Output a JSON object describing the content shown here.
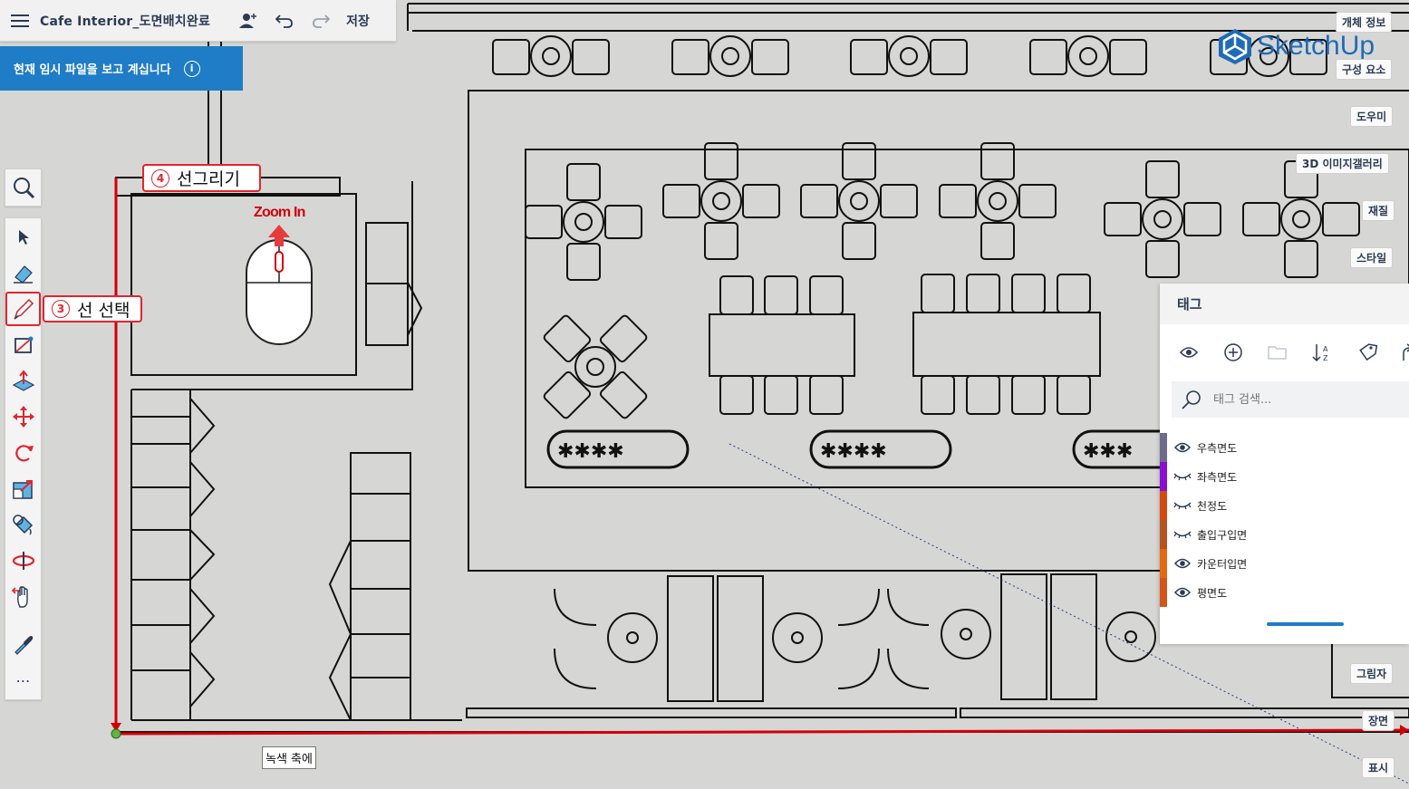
{
  "app": {
    "title": "Cafe Interior_도면배치완료",
    "save_label": "저장",
    "banner_text": "현재 임시 파일을 보고 계십니다",
    "brand": "SketchUp",
    "accent_color": "#1f7cc6",
    "callout_color": "#e0262d"
  },
  "toolbar": {
    "tools": [
      "search-icon",
      "select-arrow-icon",
      "eraser-icon",
      "pencil-line-icon",
      "rectangle-icon",
      "push-pull-icon",
      "move-icon",
      "rotate-icon",
      "scale-icon",
      "paint-bucket-icon",
      "orbit-icon",
      "pan-hand-icon",
      "eyedropper-icon",
      "more-icon"
    ],
    "active_tool": "pencil-line-icon",
    "more_label": "⋯"
  },
  "annotations": {
    "select_line": {
      "num": "3",
      "text": "선 선택"
    },
    "draw_line": {
      "num": "4",
      "text": "선그리기"
    },
    "zoom_label": "Zoom In"
  },
  "right_tabs": [
    "개체 정보",
    "구성 요소",
    "도우미",
    "3D 이미지갤러리",
    "재질",
    "스타일",
    "그림자",
    "장면",
    "표시"
  ],
  "tags_panel": {
    "title": "태그",
    "search_placeholder": "태그 검색...",
    "actions": [
      "eye-icon",
      "add-tag-icon",
      "folder-icon",
      "sort-az-icon",
      "tag-tool-icon",
      "share-icon"
    ],
    "tags": [
      {
        "name": "우측면도",
        "visible": true,
        "color": "#6d6a8c"
      },
      {
        "name": "좌측면도",
        "visible": false,
        "color": "#8a0fd1"
      },
      {
        "name": "천정도",
        "visible": false,
        "color": "#d24a12"
      },
      {
        "name": "출입구입면",
        "visible": false,
        "color": "#b3541e"
      },
      {
        "name": "카운터입면",
        "visible": true,
        "color": "#e06a12"
      },
      {
        "name": "평면도",
        "visible": true,
        "color": "#d2561a"
      }
    ]
  },
  "axis_tooltip": "녹색 축에"
}
